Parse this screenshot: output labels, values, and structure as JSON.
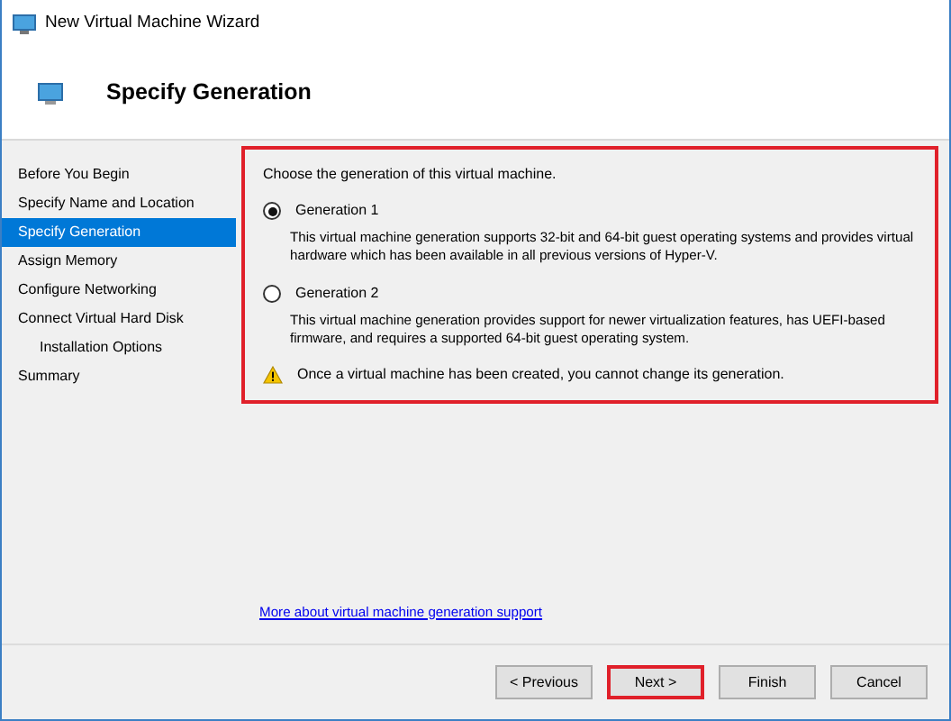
{
  "window": {
    "title": "New Virtual Machine Wizard"
  },
  "header": {
    "title": "Specify Generation"
  },
  "steps": [
    {
      "label": "Before You Begin",
      "selected": false
    },
    {
      "label": "Specify Name and Location",
      "selected": false
    },
    {
      "label": "Specify Generation",
      "selected": true
    },
    {
      "label": "Assign Memory",
      "selected": false
    },
    {
      "label": "Configure Networking",
      "selected": false
    },
    {
      "label": "Connect Virtual Hard Disk",
      "selected": false,
      "children": [
        {
          "label": "Installation Options",
          "selected": false
        }
      ]
    },
    {
      "label": "Summary",
      "selected": false
    }
  ],
  "content": {
    "highlighted": true,
    "intro": "Choose the generation of this virtual machine.",
    "options": [
      {
        "label": "Generation 1",
        "selected": true,
        "description": "This virtual machine generation supports 32-bit and 64-bit guest operating systems and provides virtual hardware which has been available in all previous versions of Hyper-V."
      },
      {
        "label": "Generation 2",
        "selected": false,
        "description": "This virtual machine generation provides support for newer virtualization features, has UEFI-based firmware, and requires a supported 64-bit guest operating system."
      }
    ],
    "warning": "Once a virtual machine has been created, you cannot change its generation."
  },
  "link": "More about virtual machine generation support",
  "buttons": [
    {
      "label": "< Previous",
      "highlighted": false
    },
    {
      "label": "Next >",
      "highlighted": true
    },
    {
      "label": "Finish",
      "highlighted": false
    },
    {
      "label": "Cancel",
      "highlighted": false
    }
  ]
}
